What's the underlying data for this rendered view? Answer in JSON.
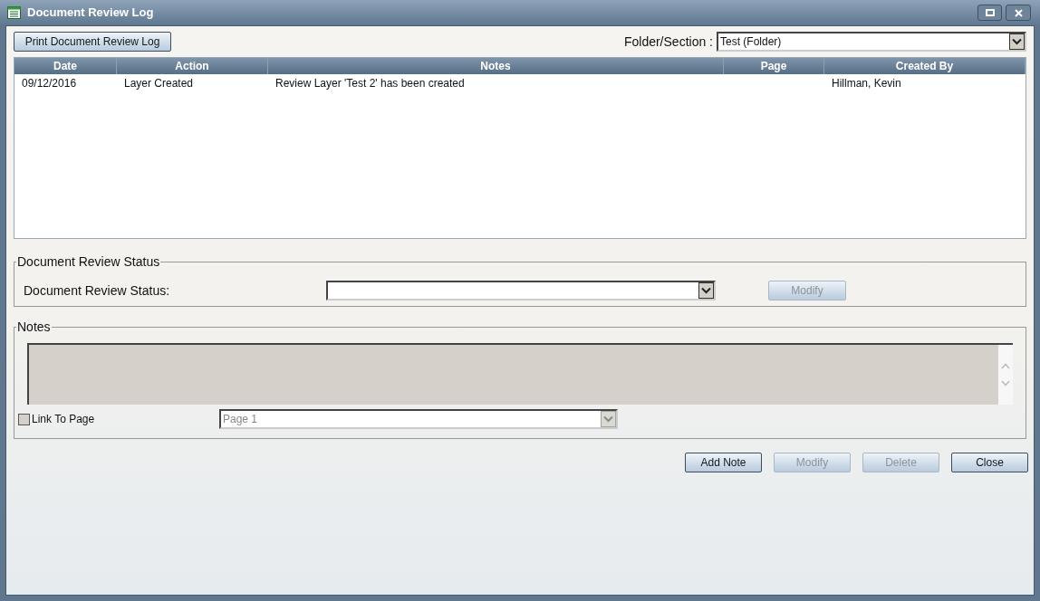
{
  "window": {
    "title": "Document Review Log"
  },
  "print_button": {
    "label": "Print Document Review Log"
  },
  "folder_section": {
    "label": "Folder/Section :",
    "value": "Test (Folder)"
  },
  "table": {
    "columns": [
      "Date",
      "Action",
      "Notes",
      "Page",
      "Created By"
    ],
    "rows": [
      [
        "09/12/2016",
        "Layer Created",
        "Review Layer 'Test 2' has been created",
        "",
        "Hillman, Kevin"
      ]
    ]
  },
  "review_status_group": {
    "title": "Document Review Status",
    "label": "Document Review Status:",
    "modify_button": {
      "label": "Modify",
      "disabled": true
    }
  },
  "notes_group": {
    "title": "Notes",
    "link_to_page": {
      "label": "Link To Page",
      "checked": false
    },
    "page_select": {
      "value": "Page 1",
      "disabled": true
    }
  },
  "buttons": [
    {
      "label": "Add Note",
      "disabled": false
    },
    {
      "label": "Modify",
      "disabled": true
    },
    {
      "label": "Delete",
      "disabled": true
    },
    {
      "label": "Close",
      "disabled": false
    }
  ]
}
